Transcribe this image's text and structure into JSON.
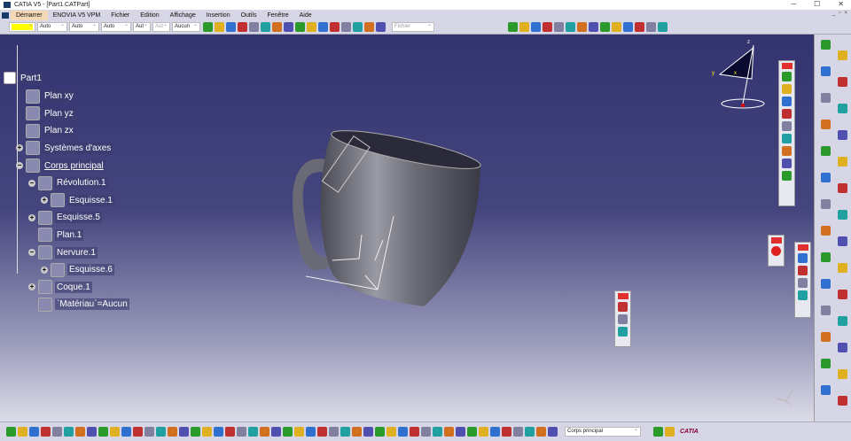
{
  "window": {
    "title": "CATIA V5 - [Part1.CATPart]",
    "minimize": "─",
    "maximize": "☐",
    "close": "✕"
  },
  "menu": [
    "Démarrer",
    "ENOVIA V5 VPM",
    "Fichier",
    "Edition",
    "Affichage",
    "Insertion",
    "Outils",
    "Fenêtre",
    "Aide"
  ],
  "toolbar": {
    "color_value": "",
    "line_type": "Auto",
    "line_weight": "Auto",
    "line_style": "Auto",
    "layer": "Aut",
    "layer2": "Aut",
    "render": "Aucun",
    "fichier": "Fichier",
    "icons": [
      "paint-brush-icon",
      "material-icon",
      "pan-icon",
      "rotate-icon",
      "fly-icon",
      "measure-icon",
      "snap-icon",
      "axis-icon",
      "constraint-icon",
      "analysis-icon",
      "knowledge-icon",
      "formula-icon",
      "law-icon",
      "table-icon",
      "macro-icon",
      "help-icon",
      "catalog-icon",
      "sketch-icon",
      "spline-icon",
      "surface-icon",
      "render-icon",
      "zoom-in-icon",
      "zoom-out-icon",
      "multi-view-icon",
      "view-icon",
      "compass-icon",
      "shading-icon",
      "shading2-icon",
      "shading3-icon",
      "tools-icon"
    ]
  },
  "tree": {
    "root": "Part1",
    "items": [
      {
        "label": "Plan xy",
        "level": 1,
        "pm": ""
      },
      {
        "label": "Plan yz",
        "level": 1,
        "pm": ""
      },
      {
        "label": "Plan zx",
        "level": 1,
        "pm": ""
      },
      {
        "label": "Systèmes d'axes",
        "level": 1,
        "pm": "+"
      },
      {
        "label": "Corps principal",
        "level": 1,
        "pm": "−"
      },
      {
        "label": "Révolution.1",
        "level": 2,
        "pm": "−"
      },
      {
        "label": "Esquisse.1",
        "level": 3,
        "pm": "+"
      },
      {
        "label": "Esquisse.5",
        "level": 2,
        "pm": "+"
      },
      {
        "label": "Plan.1",
        "level": 2,
        "pm": ""
      },
      {
        "label": "Nervure.1",
        "level": 2,
        "pm": "−"
      },
      {
        "label": "Esquisse.6",
        "level": 3,
        "pm": "+"
      },
      {
        "label": "Coque.1",
        "level": 2,
        "pm": "+"
      },
      {
        "label": "`Matériau`=Aucun",
        "level": 2,
        "pm": ""
      }
    ]
  },
  "compass": {
    "x": "x",
    "y": "y",
    "z": "z"
  },
  "bottom": {
    "current_body": "Corps principal",
    "logo": "CATIA"
  },
  "colors": {
    "accent": "#f4d9b4",
    "bg_top": "#333370",
    "swatch": "#ffff00"
  }
}
